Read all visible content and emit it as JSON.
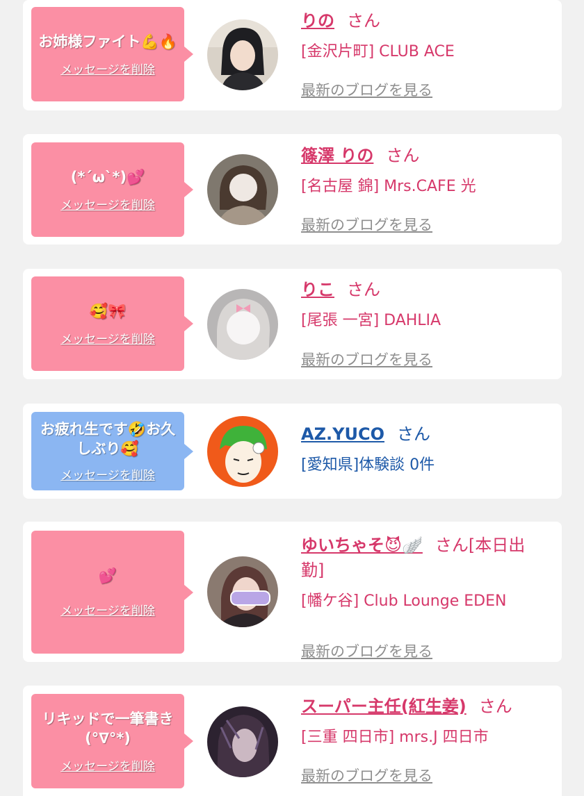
{
  "delete_label": "メッセージを削除",
  "blog_label": "最新のブログを見る",
  "san_label": "さん",
  "cards": [
    {
      "message": "お姉様ファイト💪🔥",
      "name": "りの",
      "shop": "[金沢片町] CLUB ACE"
    },
    {
      "message": "(*´ω`*)💕",
      "name": "篠澤 りの",
      "shop": "[名古屋 錦] Mrs.CAFE 光"
    },
    {
      "message": "🥰🎀",
      "name": "りこ",
      "shop": "[尾張 一宮] DAHLIA"
    },
    {
      "message": "お疲れ生です🤣お久しぶり🥰",
      "name": "AZ.YUCO",
      "shop": "[愛知県]体験談 0件"
    },
    {
      "message": "💕",
      "name": "ゆいちゃそ😈🪽",
      "san_suffix": "[本日出勤]",
      "shop": "[幡ケ谷] Club Lounge EDEN"
    },
    {
      "message": "リキッドで一筆書き(°∇°*)",
      "name": "スーパー主任(紅生姜)",
      "shop": "[三重 四日市] mrs.J 四日市"
    }
  ],
  "colors": {
    "bubble_pink": "#fb8fa4",
    "bubble_blue": "#8bb6f2",
    "name_pink": "#d6386a",
    "name_blue": "#1d59a8",
    "blog_gray": "#8e8e8e"
  }
}
